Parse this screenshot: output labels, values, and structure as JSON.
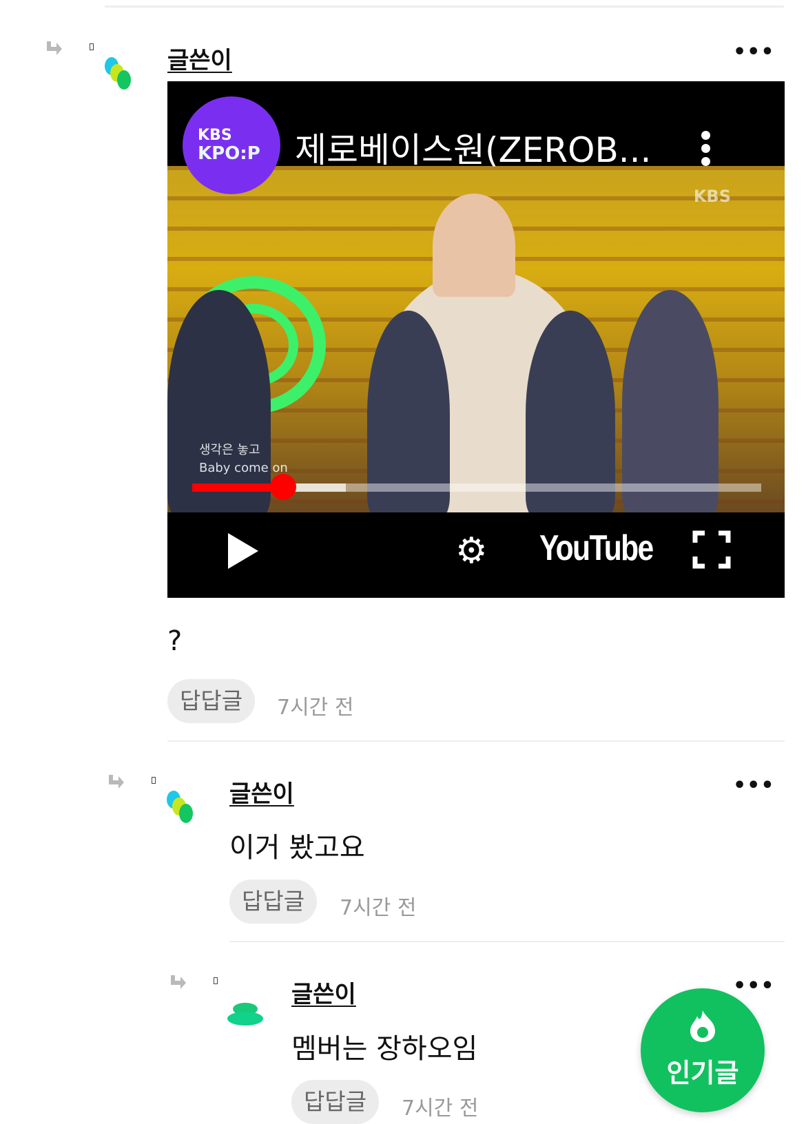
{
  "comments": [
    {
      "author": "글쓴이",
      "more": "•••",
      "body": "?",
      "reply_label": "답답글",
      "time": "7시간 전",
      "video": {
        "channel_logo_line1": "KBS",
        "channel_logo_line2": "KPO:P",
        "title": "제로베이스원(ZEROB...",
        "watermark": "KBS",
        "caption_line1": "생각은 놓고",
        "caption_line2": "Baby come on",
        "brand": "YouTube",
        "progress": 0.16,
        "buffered": 0.27
      }
    },
    {
      "author": "글쓴이",
      "more": "•••",
      "body": "이거 봤고요",
      "reply_label": "답답글",
      "time": "7시간 전"
    },
    {
      "author": "글쓴이",
      "more": "•••",
      "body": "멤버는 장하오임",
      "reply_label": "답답글",
      "time": "7시간 전"
    }
  ],
  "popular_button": {
    "label": "인기글"
  },
  "colors": {
    "accent_green": "#11c15f",
    "youtube_red": "#ff0000",
    "channel_purple": "#7a2ff0"
  },
  "icons": [
    "reply-arrow-icon",
    "avatar-icon",
    "more-icon",
    "play-icon",
    "settings-gear-icon",
    "fullscreen-icon",
    "flame-icon"
  ]
}
